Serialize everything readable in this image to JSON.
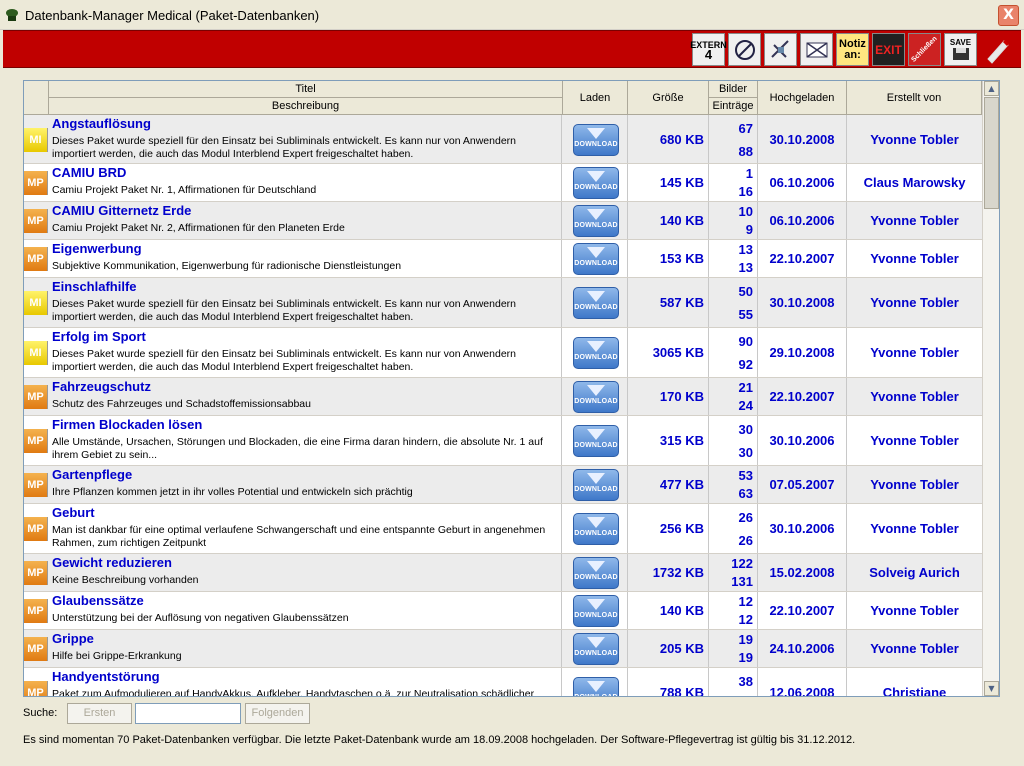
{
  "window": {
    "title": "Datenbank-Manager Medical (Paket-Datenbanken)",
    "close": "X"
  },
  "toolbar": {
    "extern_top": "EXTERN",
    "extern_num": "4",
    "notiz_line1": "Notiz",
    "notiz_line2": "an:",
    "exit": "EXIT",
    "schliessen": "Schließen",
    "save": "SAVE"
  },
  "columns": {
    "titel": "Titel",
    "beschreibung": "Beschreibung",
    "laden": "Laden",
    "groesse": "Größe",
    "bilder": "Bilder",
    "eintraege": "Einträge",
    "hochgeladen": "Hochgeladen",
    "erstellt": "Erstellt von"
  },
  "download_label": "DOWNLOAD",
  "rows": [
    {
      "badge": "MI",
      "title": "Angstauflösung",
      "desc": "Dieses Paket wurde speziell für den Einsatz bei Subliminals entwickelt. Es kann nur von Anwendern importiert werden, die auch das Modul Interblend Expert freigeschaltet haben.",
      "size": "680 KB",
      "bilder": "67",
      "eintraege": "88",
      "date": "30.10.2008",
      "author": "Yvonne Tobler"
    },
    {
      "badge": "MP",
      "title": "CAMIU BRD",
      "desc": "Camiu Projekt Paket Nr. 1, Affirmationen für Deutschland",
      "size": "145 KB",
      "bilder": "1",
      "eintraege": "16",
      "date": "06.10.2006",
      "author": "Claus Marowsky"
    },
    {
      "badge": "MP",
      "title": "CAMIU Gitternetz Erde",
      "desc": "Camiu Projekt Paket Nr. 2, Affirmationen für den Planeten Erde",
      "size": "140 KB",
      "bilder": "10",
      "eintraege": "9",
      "date": "06.10.2006",
      "author": "Yvonne Tobler"
    },
    {
      "badge": "MP",
      "title": "Eigenwerbung",
      "desc": "Subjektive Kommunikation, Eigenwerbung für radionische Dienstleistungen",
      "size": "153 KB",
      "bilder": "13",
      "eintraege": "13",
      "date": "22.10.2007",
      "author": "Yvonne Tobler"
    },
    {
      "badge": "MI",
      "title": "Einschlafhilfe",
      "desc": "Dieses Paket wurde speziell für den Einsatz bei Subliminals entwickelt. Es kann nur von Anwendern importiert werden, die auch das Modul Interblend Expert freigeschaltet haben.",
      "size": "587 KB",
      "bilder": "50",
      "eintraege": "55",
      "date": "30.10.2008",
      "author": "Yvonne Tobler"
    },
    {
      "badge": "MI",
      "title": "Erfolg im Sport",
      "desc": "Dieses Paket wurde speziell für den Einsatz bei Subliminals entwickelt. Es kann nur von Anwendern importiert werden, die auch das Modul Interblend Expert freigeschaltet haben.",
      "size": "3065 KB",
      "bilder": "90",
      "eintraege": "92",
      "date": "29.10.2008",
      "author": "Yvonne Tobler"
    },
    {
      "badge": "MP",
      "title": "Fahrzeugschutz",
      "desc": "Schutz des Fahrzeuges und Schadstoffemissionsabbau",
      "size": "170 KB",
      "bilder": "21",
      "eintraege": "24",
      "date": "22.10.2007",
      "author": "Yvonne Tobler"
    },
    {
      "badge": "MP",
      "title": "Firmen Blockaden lösen",
      "desc": "Alle Umstände, Ursachen, Störungen und Blockaden, die eine Firma daran hindern, die absolute Nr. 1 auf ihrem Gebiet zu sein...",
      "size": "315 KB",
      "bilder": "30",
      "eintraege": "30",
      "date": "30.10.2006",
      "author": "Yvonne Tobler"
    },
    {
      "badge": "MP",
      "title": "Gartenpflege",
      "desc": "Ihre Pflanzen kommen jetzt in ihr volles Potential und entwickeln sich prächtig",
      "size": "477 KB",
      "bilder": "53",
      "eintraege": "63",
      "date": "07.05.2007",
      "author": "Yvonne Tobler"
    },
    {
      "badge": "MP",
      "title": "Geburt",
      "desc": "Man ist dankbar für eine optimal verlaufene Schwangerschaft und eine entspannte Geburt in angenehmen Rahmen, zum richtigen Zeitpunkt",
      "size": "256 KB",
      "bilder": "26",
      "eintraege": "26",
      "date": "30.10.2006",
      "author": "Yvonne Tobler"
    },
    {
      "badge": "MP",
      "title": "Gewicht reduzieren",
      "desc": "Keine Beschreibung vorhanden",
      "size": "1732 KB",
      "bilder": "122",
      "eintraege": "131",
      "date": "15.02.2008",
      "author": "Solveig Aurich"
    },
    {
      "badge": "MP",
      "title": "Glaubenssätze",
      "desc": "Unterstützung bei der Auflösung von negativen Glaubenssätzen",
      "size": "140 KB",
      "bilder": "12",
      "eintraege": "12",
      "date": "22.10.2007",
      "author": "Yvonne Tobler"
    },
    {
      "badge": "MP",
      "title": "Grippe",
      "desc": "Hilfe bei Grippe-Erkrankung",
      "size": "205 KB",
      "bilder": "19",
      "eintraege": "19",
      "date": "24.10.2006",
      "author": "Yvonne Tobler"
    },
    {
      "badge": "MP",
      "title": "Handyentstörung",
      "desc": "Paket zum Aufmodulieren auf HandyAkkus, Aufkleber, Handytaschen o.ä. zur Neutralisation schädlicher",
      "size": "788 KB",
      "bilder": "38",
      "eintraege": "",
      "date": "12.06.2008",
      "author": "Christiane"
    }
  ],
  "search": {
    "label": "Suche:",
    "first": "Ersten",
    "next": "Folgenden",
    "value": ""
  },
  "status": "Es sind momentan 70 Paket-Datenbanken verfügbar. Die letzte Paket-Datenbank wurde am 18.09.2008 hochgeladen. Der Software-Pflegevertrag ist gültig bis 31.12.2012."
}
